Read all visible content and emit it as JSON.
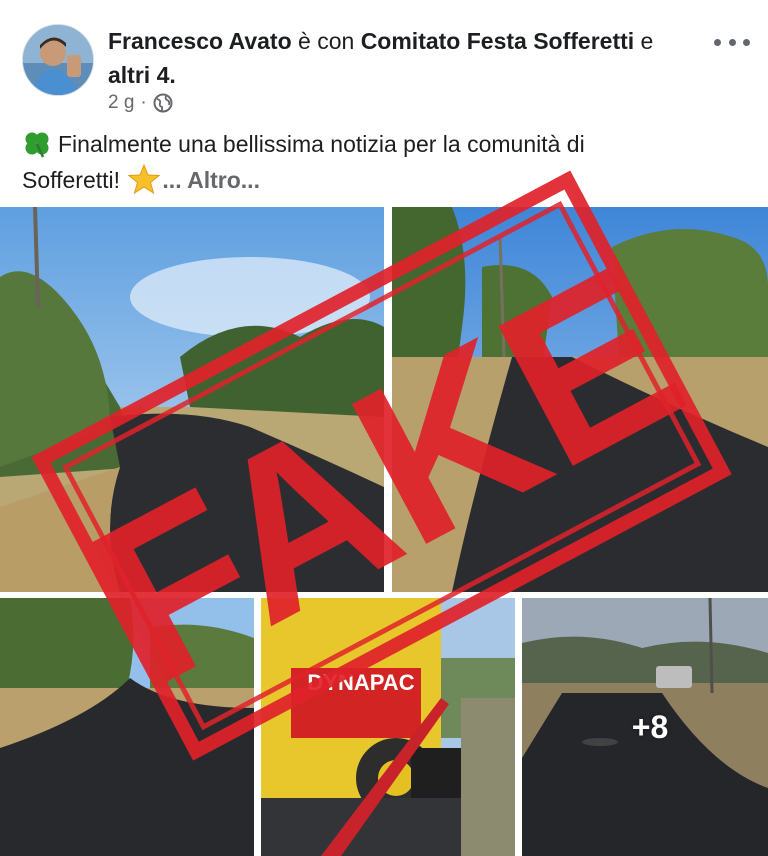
{
  "post": {
    "author": "Francesco Avato",
    "connector": " è con ",
    "tagged": "Comitato Festa Sofferetti",
    "connector2": " e ",
    "others": "altri 4.",
    "time": "2 g",
    "dot": "·",
    "text_line1": "Finalmente una bellissima notizia per la comunità di",
    "text_line2": "Sofferetti!",
    "more": "... Altro...",
    "icons": [
      "clover-emoji",
      "star-emoji",
      "globe-icon",
      "more-options-icon"
    ]
  },
  "gallery": {
    "extra_count": "+8",
    "paver_brand": "DYNAPAC"
  },
  "stamp": {
    "text": "FAKE",
    "color": "#e0222a"
  }
}
